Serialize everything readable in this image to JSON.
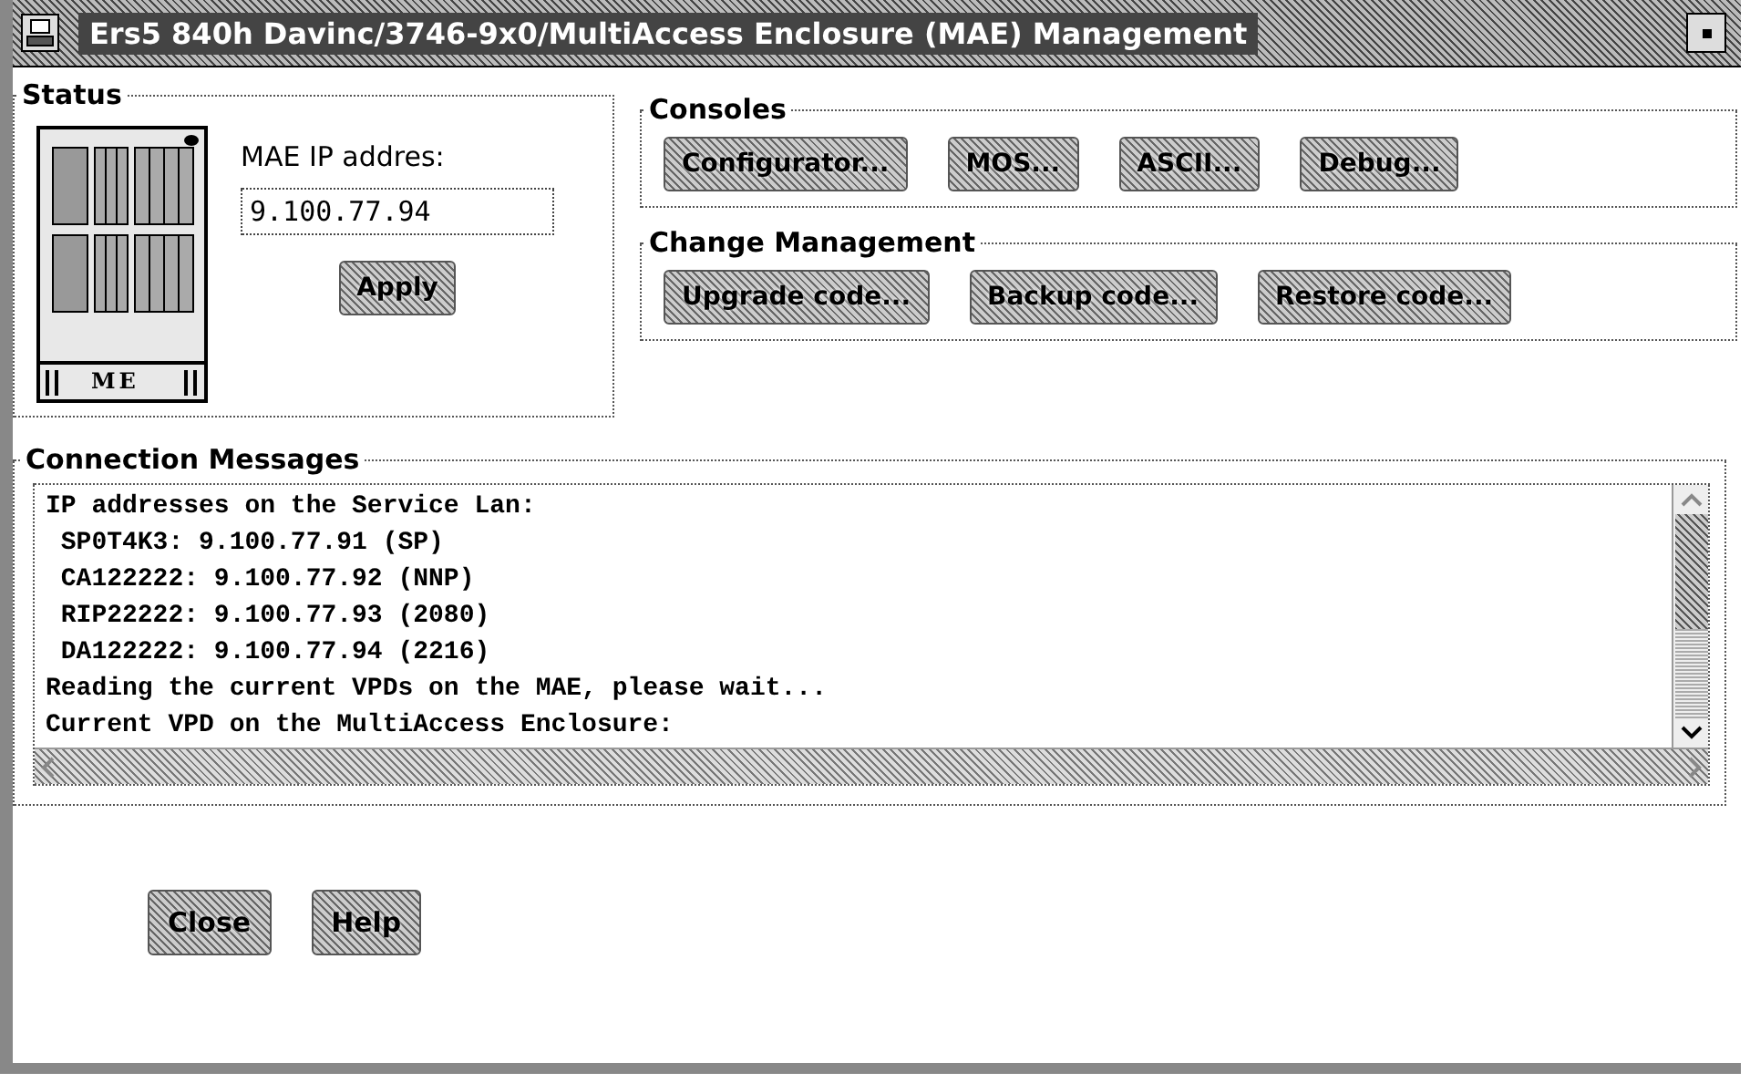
{
  "window": {
    "title": "Ers5 840h Davinc/3746-9x0/MultiAccess Enclosure (MAE) Management"
  },
  "status": {
    "title": "Status",
    "device_label": "ME",
    "ip_label": "MAE IP addres:",
    "ip_value": "9.100.77.94",
    "apply_button": "Apply"
  },
  "consoles": {
    "title": "Consoles",
    "buttons": [
      "Configurator...",
      "MOS...",
      "ASCII...",
      "Debug..."
    ]
  },
  "change_management": {
    "title": "Change Management",
    "buttons": [
      "Upgrade code...",
      "Backup code...",
      "Restore code..."
    ]
  },
  "connection_messages": {
    "title": "Connection Messages",
    "lines": [
      "IP addresses on the Service Lan:",
      " SP0T4K3: 9.100.77.91 (SP)",
      " CA122222: 9.100.77.92 (NNP)",
      " RIP22222: 9.100.77.93 (2080)",
      " DA122222: 9.100.77.94 (2216)",
      "Reading the current VPDs on the MAE, please wait...",
      "Current VPD on the MultiAccess Enclosure:"
    ]
  },
  "buttons": [
    "Close",
    "Help"
  ]
}
